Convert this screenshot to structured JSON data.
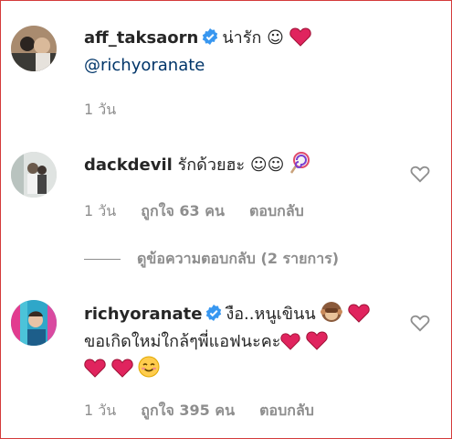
{
  "comments": [
    {
      "username": "aff_taksaorn",
      "verified": true,
      "text": "น่ารัก ☺",
      "mention": "@richyoranate",
      "time": "1 วัน",
      "likes": "",
      "reply_label": ""
    },
    {
      "username": "dackdevil",
      "verified": false,
      "text": "รักด้วยฮะ ☺☺",
      "time": "1 วัน",
      "likes": "ถูกใจ 63 คน",
      "reply_label": "ตอบกลับ"
    },
    {
      "username": "richyoranate",
      "verified": true,
      "text": "งือ..หนูเขินน",
      "text2": "ขอเกิดใหม่ใกล้ๆพี่แอฟนะคะ",
      "time": "1 วัน",
      "likes": "ถูกใจ 395 คน",
      "reply_label": "ตอบกลับ"
    }
  ],
  "view_replies": "ดูข้อความตอบกลับ (2 รายการ)",
  "colors": {
    "verified": "#3897f0",
    "heart": "#e0245e",
    "mention": "#003569",
    "meta": "#8e8e8e",
    "frame": "#d43b3b"
  },
  "icons": [
    "verified-badge-icon",
    "red-heart-icon",
    "lollipop-icon",
    "monkey-icon",
    "smiling-face-icon",
    "like-heart-outline-icon"
  ]
}
